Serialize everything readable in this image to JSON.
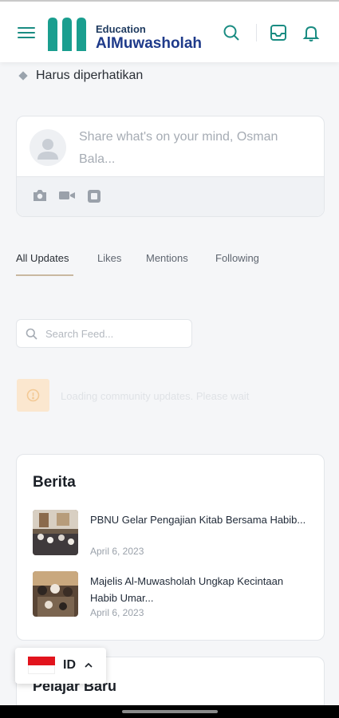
{
  "header": {
    "logo_small": "Education",
    "logo_big": "AlMuwasholah",
    "brand_color": "#1a9e8f",
    "icons": [
      "menu-icon",
      "search-icon",
      "inbox-icon",
      "bell-icon"
    ]
  },
  "notice": {
    "text": "Harus diperhatikan"
  },
  "composer": {
    "placeholder": "Share what's on your mind, Osman Bala...",
    "tools": [
      "camera-icon",
      "video-icon",
      "gif-icon"
    ]
  },
  "tabs": {
    "items": [
      "All Updates",
      "Likes",
      "Mentions",
      "Following"
    ],
    "active": "All Updates"
  },
  "search": {
    "placeholder": "Search Feed..."
  },
  "loading": {
    "text": "Loading community updates. Please wait"
  },
  "news": {
    "title": "Berita",
    "items": [
      {
        "title": "PBNU Gelar Pengajian Kitab Bersama Habib...",
        "date": "April 6, 2023"
      },
      {
        "title": "Majelis Al-Muwasholah Ungkap Kecintaan Habib Umar...",
        "date": "April 6, 2023"
      }
    ]
  },
  "pelajar": {
    "title": "Pelajar Baru"
  },
  "language": {
    "code": "ID"
  }
}
